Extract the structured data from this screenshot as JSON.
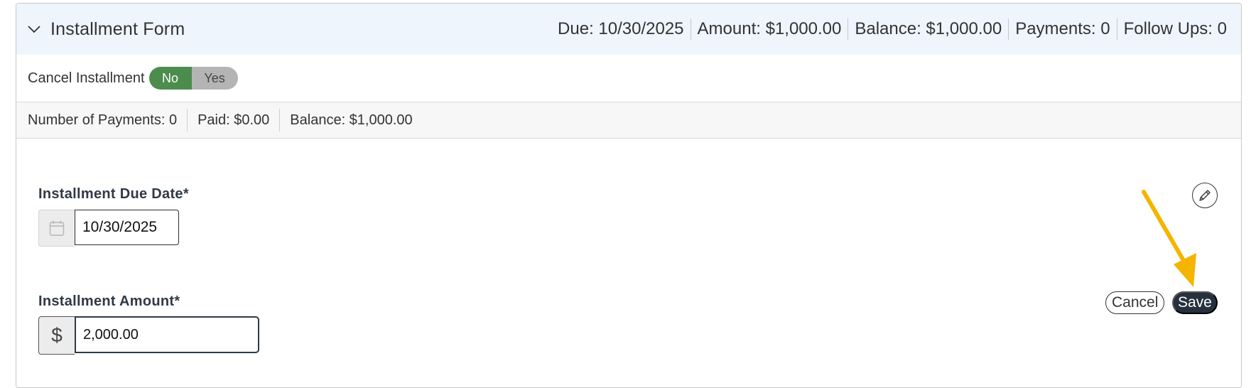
{
  "header": {
    "title": "Installment Form",
    "due": "Due: 10/30/2025",
    "amount": "Amount: $1,000.00",
    "balance": "Balance: $1,000.00",
    "payments": "Payments: 0",
    "follow_ups": "Follow Ups: 0"
  },
  "cancel_installment": {
    "label": "Cancel Installment",
    "no_label": "No",
    "yes_label": "Yes",
    "selected": "No"
  },
  "stats": {
    "number_of_payments": "Number of Payments: 0",
    "paid": "Paid: $0.00",
    "balance": "Balance: $1,000.00"
  },
  "fields": {
    "due_date_label": "Installment Due Date*",
    "due_date_value": "10/30/2025",
    "amount_label": "Installment Amount*",
    "amount_currency": "$",
    "amount_value": "2,000.00"
  },
  "actions": {
    "cancel_label": "Cancel",
    "save_label": "Save"
  },
  "icons": {
    "chevron": "chevron-down-icon",
    "calendar": "calendar-icon",
    "edit": "pencil-icon",
    "annotation": "arrow-annotation"
  },
  "colors": {
    "header_bg": "#eef5fd",
    "toggle_no": "#4c8c4c",
    "toggle_yes": "#b4b4b4",
    "save_bg": "#27313d",
    "annotation_arrow": "#f5b400"
  }
}
